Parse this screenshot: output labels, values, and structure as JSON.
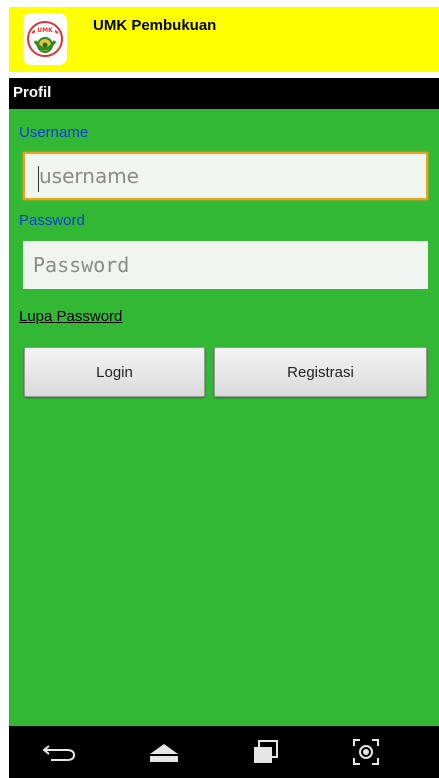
{
  "app": {
    "title": "UMK Pembukuan",
    "logo_icon": "umk-logo-icon",
    "colors": {
      "header": "#ffff00",
      "content": "#33b836",
      "label": "#0b3fd3",
      "focus": "#f0a020"
    }
  },
  "section": {
    "title": "Profil"
  },
  "form": {
    "username_label": "Username",
    "username_placeholder": "username",
    "password_label": "Password",
    "password_placeholder": "Password",
    "forgot_link": "Lupa Password",
    "login_label": "Login",
    "register_label": "Registrasi"
  },
  "navbar": {
    "icons": [
      "back-icon",
      "home-icon",
      "recent-apps-icon",
      "screenshot-icon"
    ]
  }
}
